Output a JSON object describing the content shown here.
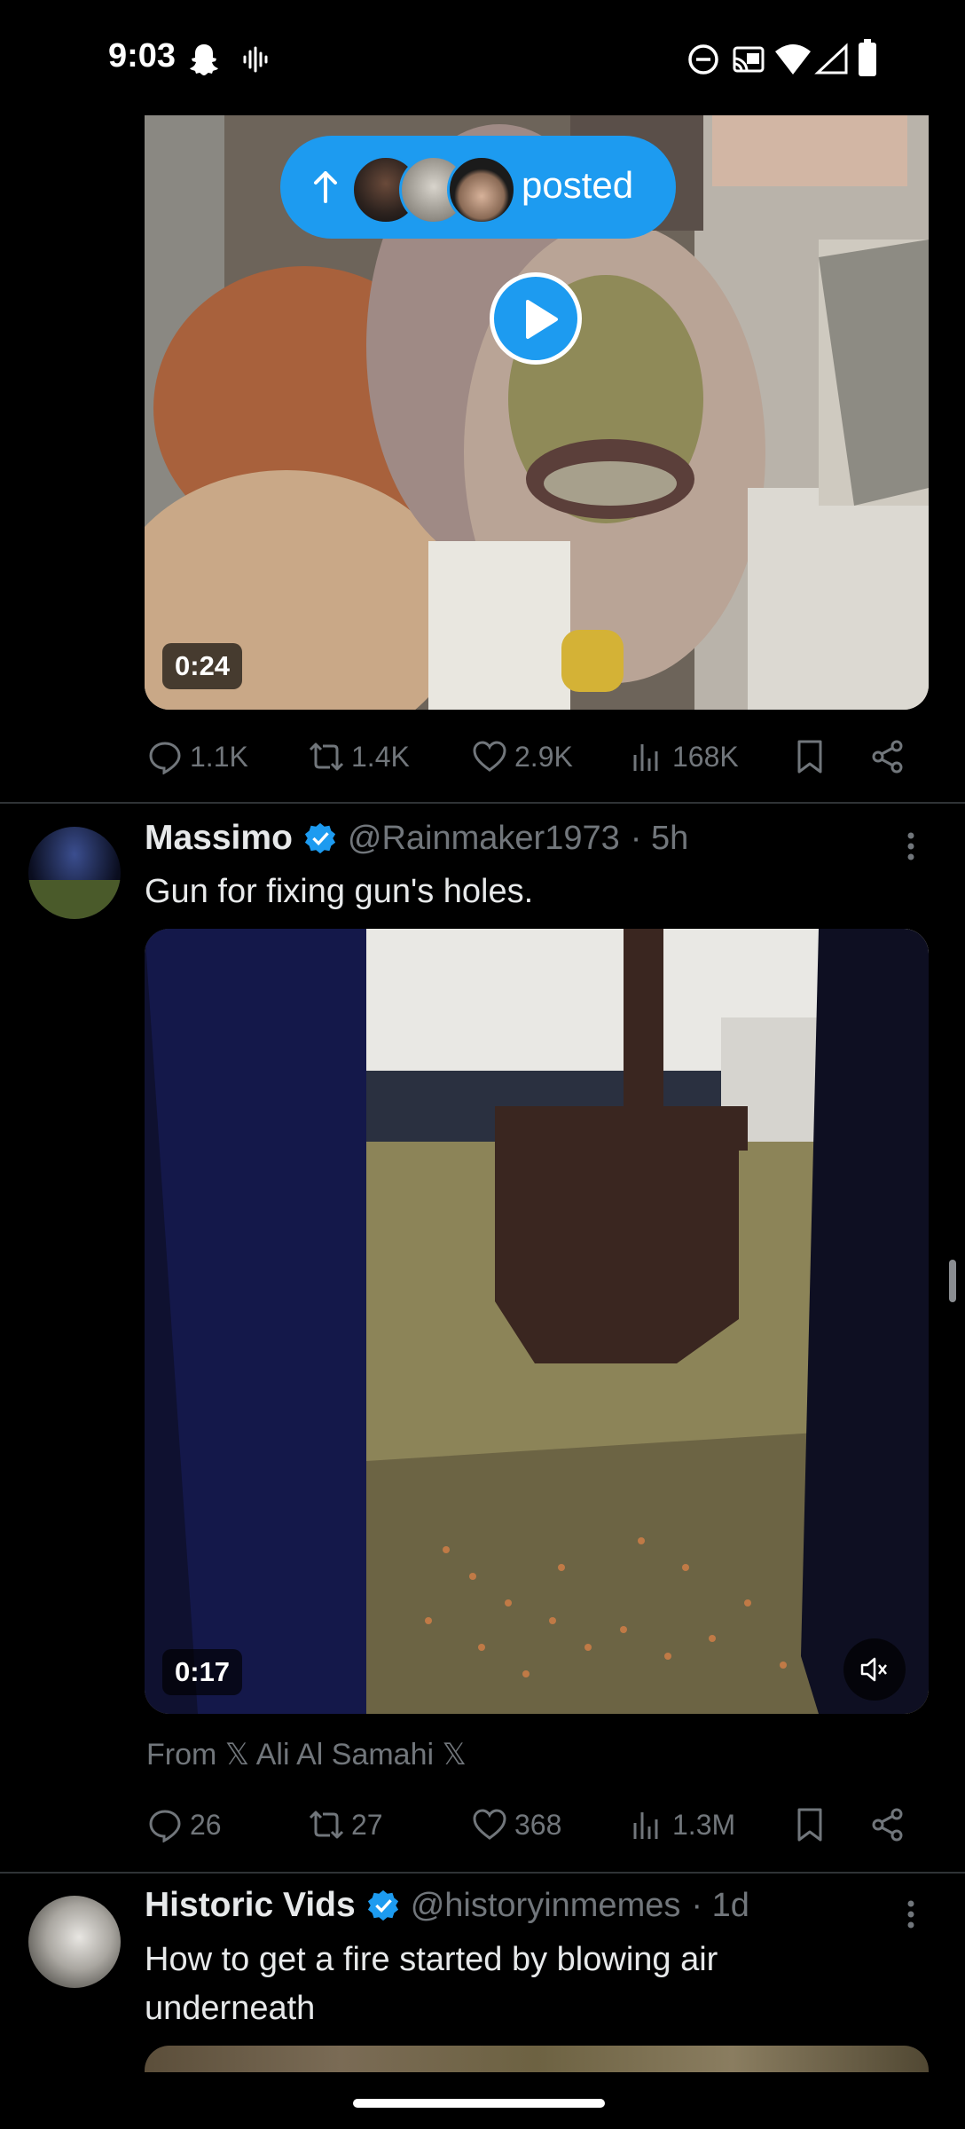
{
  "status": {
    "time": "9:03",
    "icons": [
      "snapchat-icon",
      "audio-wave-icon",
      "dnd-icon",
      "cast-icon",
      "wifi-icon",
      "signal-icon",
      "battery-icon"
    ]
  },
  "posted_pill": {
    "label": "posted"
  },
  "tweet1": {
    "duration": "0:24",
    "replies": "1.1K",
    "retweets": "1.4K",
    "likes": "2.9K",
    "views": "168K"
  },
  "tweet2": {
    "name": "Massimo",
    "handle": "@Rainmaker1973",
    "time": "· 5h",
    "text": "Gun for fixing gun's holes.",
    "duration": "0:17",
    "source": "From 𝕏 Ali Al Samahi 𝕏",
    "replies": "26",
    "retweets": "27",
    "likes": "368",
    "views": "1.3M"
  },
  "tweet3": {
    "name": "Historic Vids",
    "handle": "@historyinmemes",
    "time": "· 1d",
    "text": "How to get a fire started by blowing air underneath"
  },
  "colors": {
    "accent": "#1d9bf0",
    "muted": "#71767b",
    "divider": "#2f3336",
    "background": "#000000"
  }
}
